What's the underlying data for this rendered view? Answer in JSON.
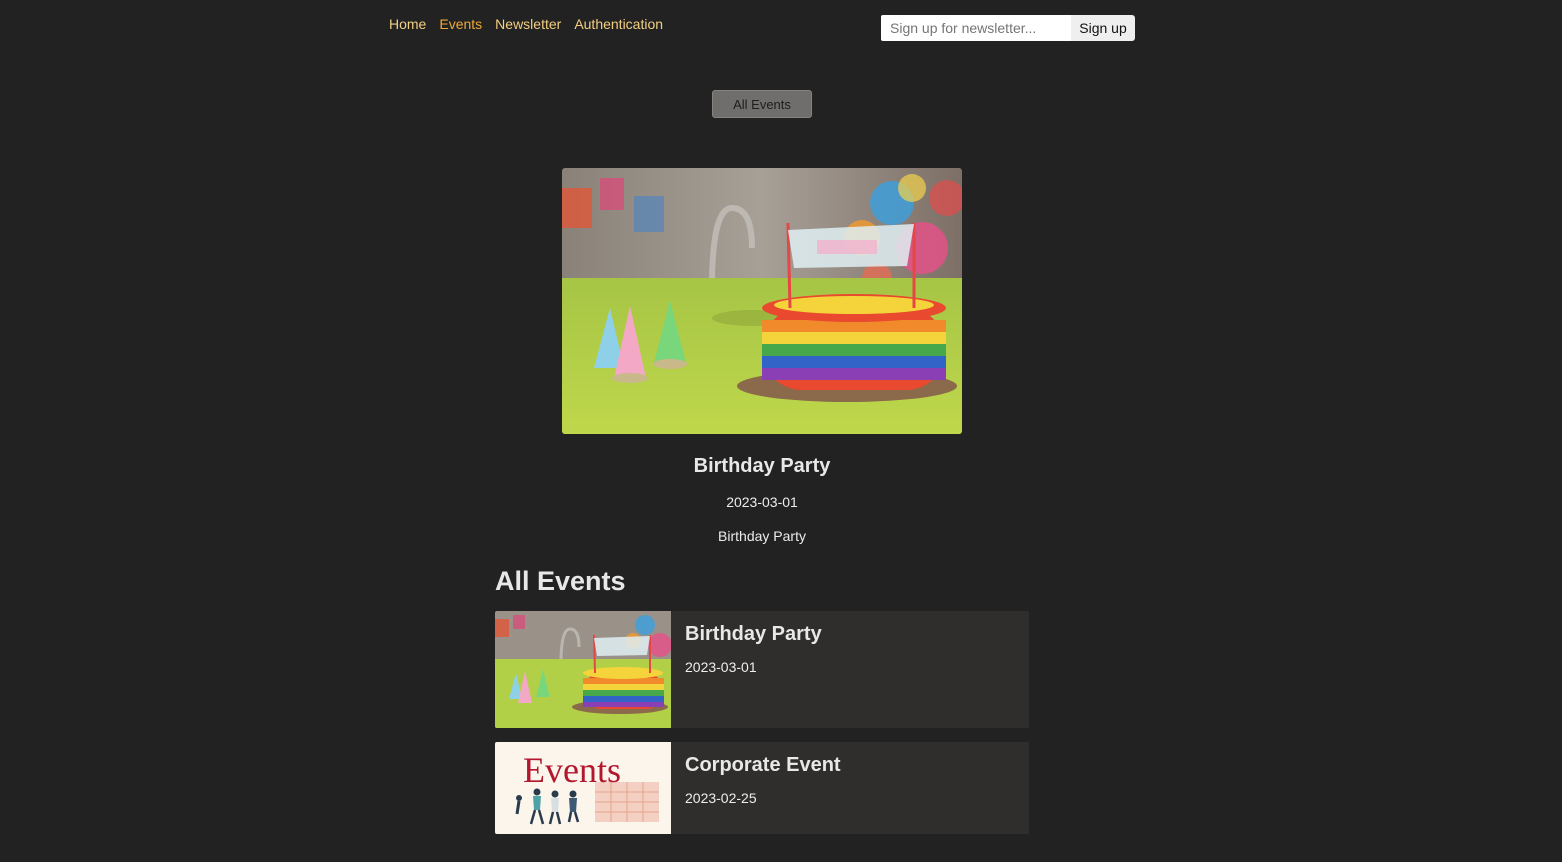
{
  "nav": {
    "items": [
      {
        "label": "Home"
      },
      {
        "label": "Events"
      },
      {
        "label": "Newsletter"
      },
      {
        "label": "Authentication"
      }
    ],
    "active": "Events"
  },
  "newsletter": {
    "placeholder": "Sign up for newsletter...",
    "value": "",
    "button_label": "Sign up"
  },
  "toolbar": {
    "all_events_label": "All Events"
  },
  "featured": {
    "title": "Birthday Party",
    "date": "2023-03-01",
    "description": "Birthday Party",
    "image": "birthday-cake-photo"
  },
  "list": {
    "heading": "All Events",
    "events": [
      {
        "title": "Birthday Party",
        "date": "2023-03-01",
        "image": "birthday-cake-photo"
      },
      {
        "title": "Corporate Event",
        "date": "2023-02-25",
        "image": "events-illustration",
        "image_text": "Events"
      }
    ]
  },
  "colors": {
    "background": "#222222",
    "nav_link": "#f3cf82",
    "nav_active": "#f0a935",
    "card": "#2f2e2c",
    "button": "#6f6e6c"
  }
}
